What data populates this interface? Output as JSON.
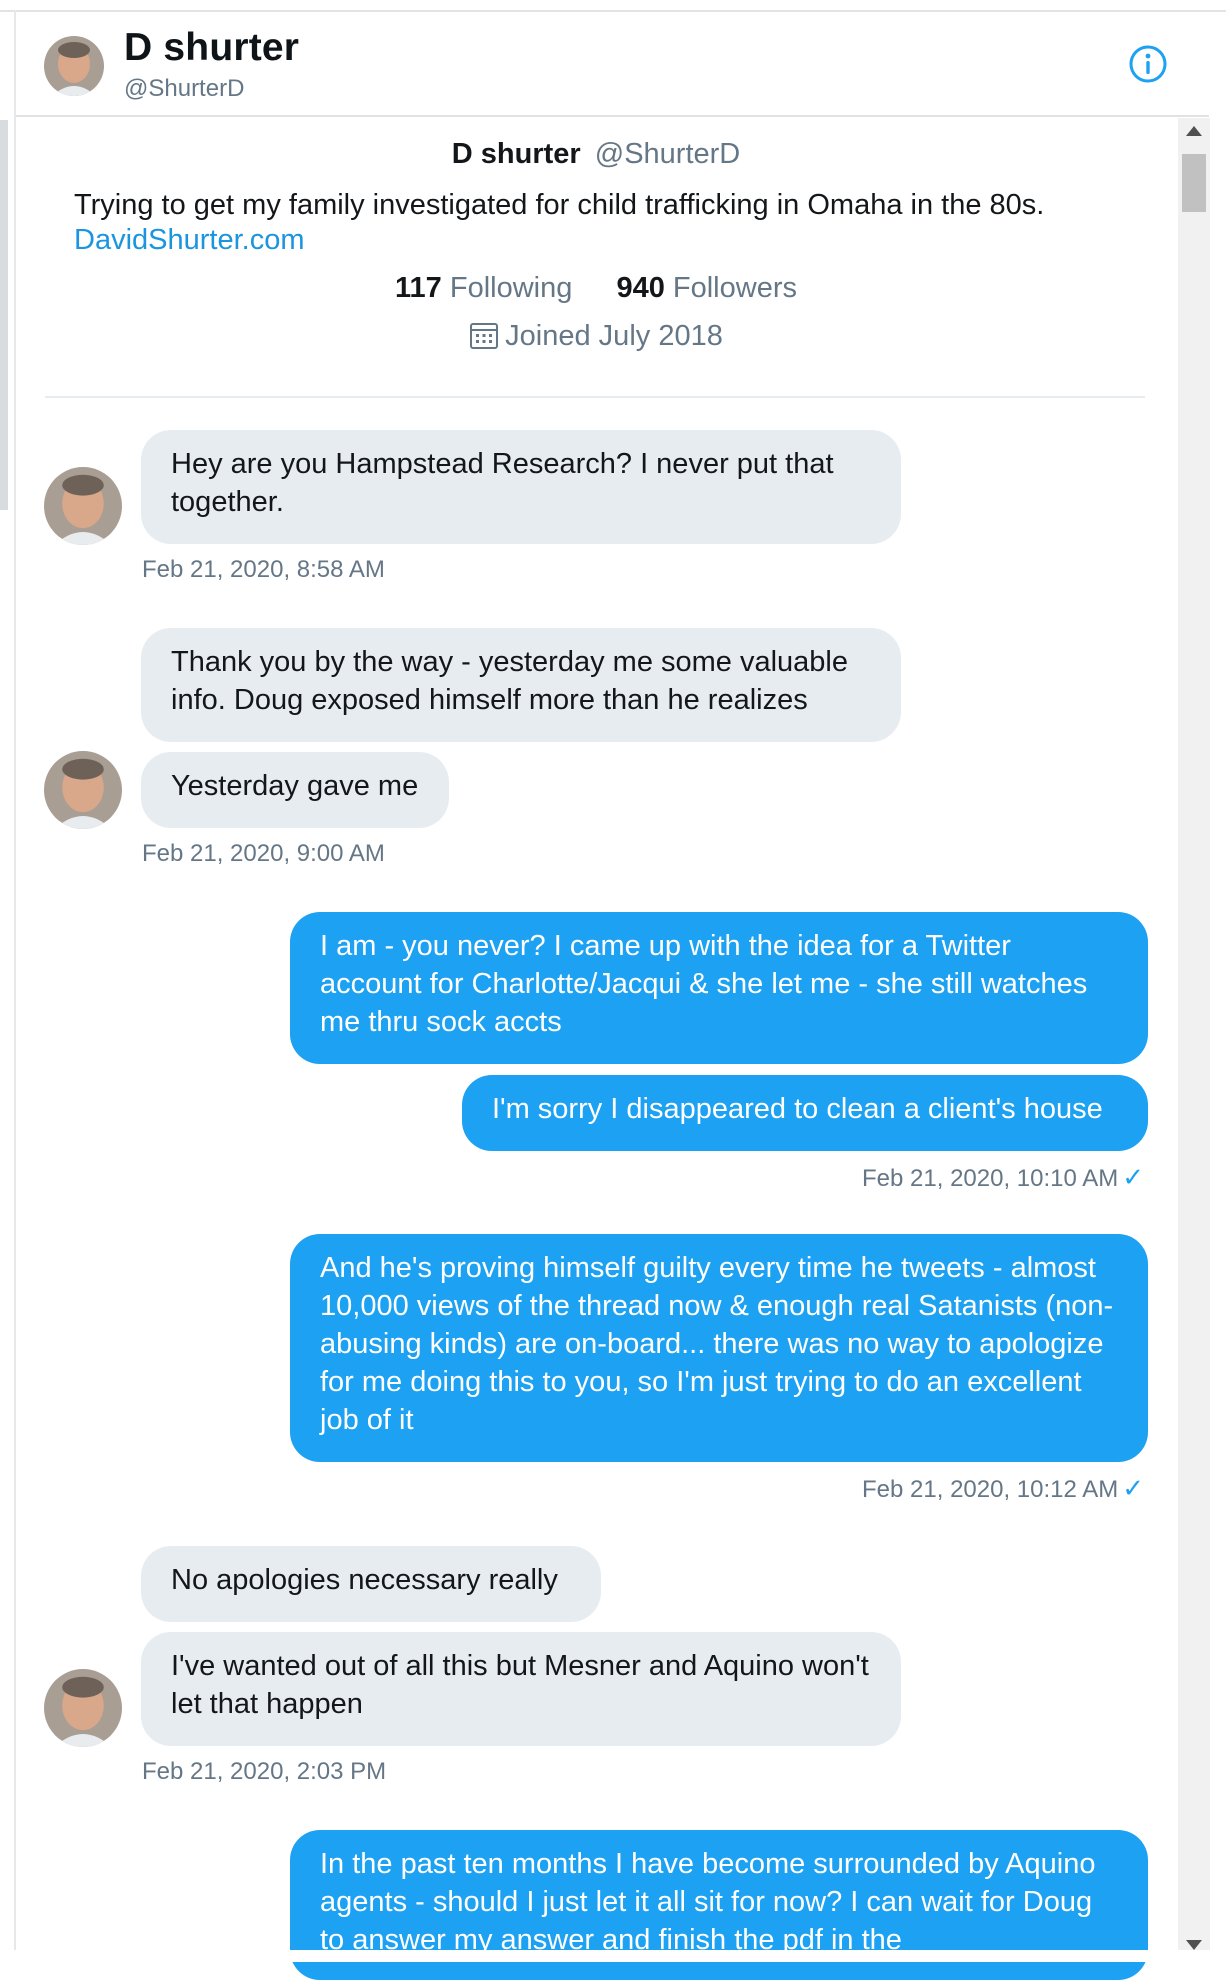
{
  "header": {
    "name": "D shurter",
    "handle": "@ShurterD",
    "info_icon": "info-circle-icon"
  },
  "profile": {
    "name": "D shurter",
    "handle": "@ShurterD",
    "bio": "Trying to get my family investigated for child trafficking in Omaha in the 80s.",
    "link": "DavidShurter.com",
    "following_count": "117",
    "following_label": "Following",
    "followers_count": "940",
    "followers_label": "Followers",
    "joined": "Joined July 2018"
  },
  "messages": [
    {
      "side": "received",
      "text": "Hey are you Hampstead Research?  I never put that together."
    },
    {
      "side": "received",
      "timestamp": "Feb 21, 2020, 8:58 AM"
    },
    {
      "side": "received",
      "text": "Thank you by the way - yesterday me some valuable info. Doug exposed himself more than he realizes"
    },
    {
      "side": "received",
      "text": "Yesterday gave me"
    },
    {
      "side": "received",
      "timestamp": "Feb 21, 2020, 9:00 AM"
    },
    {
      "side": "sent",
      "text": "I am - you never? I came up with the idea for a Twitter account for Charlotte/Jacqui & she let me - she still watches me thru sock accts"
    },
    {
      "side": "sent",
      "text": "I'm sorry I disappeared to clean a client's house"
    },
    {
      "side": "sent",
      "timestamp": "Feb 21, 2020, 10:10 AM"
    },
    {
      "side": "sent",
      "text": "And he's proving himself guilty every time he tweets - almost 10,000 views of the thread now & enough real Satanists (non-abusing kinds) are on-board... there was no way to apologize for me doing this to you, so I'm just trying to do an excellent job of it"
    },
    {
      "side": "sent",
      "timestamp": "Feb 21, 2020, 10:12 AM"
    },
    {
      "side": "received",
      "text": "No apologies necessary  really"
    },
    {
      "side": "received",
      "text": "I've wanted out of all this but Mesner and Aquino won't let that happen"
    },
    {
      "side": "received",
      "timestamp": "Feb 21, 2020, 2:03 PM"
    },
    {
      "side": "sent",
      "text": "In the past ten months I have become surrounded by Aquino agents - should I just let it all sit for now? I can wait for Doug to answer my answer and finish the pdf in the"
    }
  ],
  "read_mark": "✓",
  "colors": {
    "sent_bubble": "#1da1f2",
    "received_bubble": "#e6ecf0",
    "link": "#1b95e0",
    "muted_text": "#657786"
  }
}
